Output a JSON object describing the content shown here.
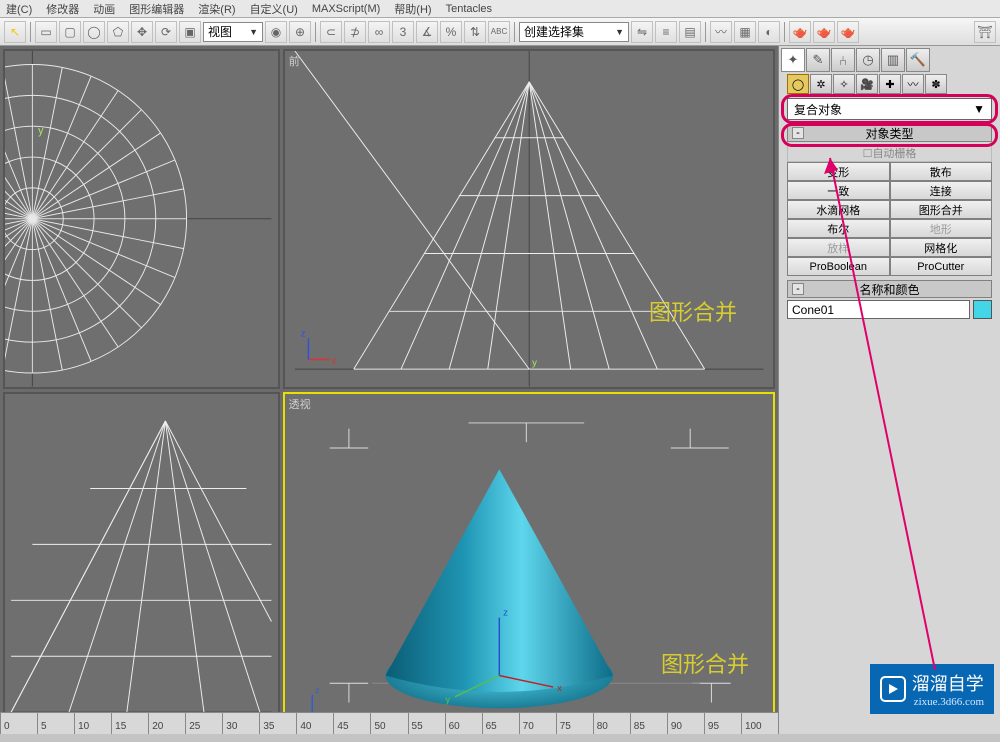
{
  "menubar": {
    "items": [
      "建(C)",
      "修改器",
      "动画",
      "图形编辑器",
      "渲染(R)",
      "自定义(U)",
      "MAXScript(M)",
      "帮助(H)",
      "Tentacles"
    ]
  },
  "toolbar": {
    "view_combo": "视图",
    "selset_combo": "创建选择集"
  },
  "viewports": {
    "top": {
      "label": ""
    },
    "front": {
      "label": "前",
      "text": "图形合并"
    },
    "left": {
      "label": ""
    },
    "persp": {
      "label": "透视",
      "text": "图形合并"
    }
  },
  "panel": {
    "category": "复合对象",
    "rollout_type": "对象类型",
    "auto_grid": "自动栅格",
    "types": [
      [
        "变形",
        "散布"
      ],
      [
        "一致",
        "连接"
      ],
      [
        "水滴网格",
        "图形合并"
      ],
      [
        "布尔",
        "地形"
      ],
      [
        "放样",
        "网格化"
      ],
      [
        "ProBoolean",
        "ProCutter"
      ]
    ],
    "rollout_name": "名称和颜色",
    "object_name": "Cone01",
    "color": "#42d6e8"
  },
  "ruler": [
    "0",
    "5",
    "10",
    "15",
    "20",
    "25",
    "30",
    "35",
    "40",
    "45",
    "50",
    "55",
    "60",
    "65",
    "70",
    "75",
    "80",
    "85",
    "90",
    "95",
    "100"
  ],
  "watermark": {
    "title": "溜溜自学",
    "sub": "zixue.3d66.com"
  }
}
